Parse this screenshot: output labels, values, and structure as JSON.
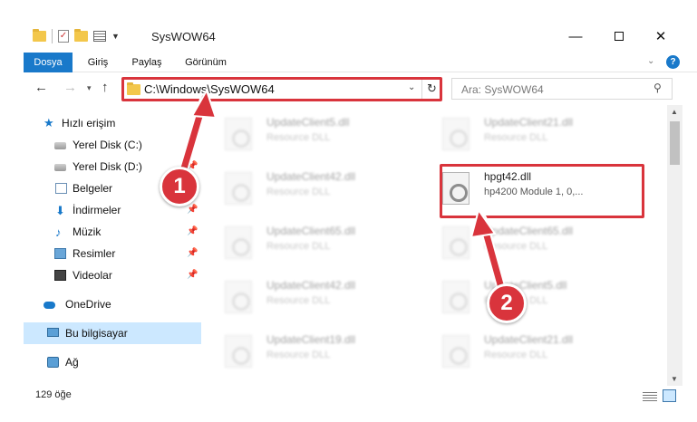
{
  "window": {
    "title": "SysWOW64",
    "minimize": "—",
    "close": "✕"
  },
  "ribbon": {
    "tabs": [
      "Dosya",
      "Giriş",
      "Paylaş",
      "Görünüm"
    ],
    "help": "?"
  },
  "address": {
    "path": "C:\\Windows\\SysWOW64",
    "search_placeholder": "Ara: SysWOW64"
  },
  "nav": {
    "items": [
      {
        "label": "Hızlı erişim",
        "icon": "star-icon"
      },
      {
        "label": "Yerel Disk (C:)",
        "icon": "drive-icon"
      },
      {
        "label": "Yerel Disk (D:)",
        "icon": "drive-icon"
      },
      {
        "label": "Belgeler",
        "icon": "documents-icon"
      },
      {
        "label": "İndirmeler",
        "icon": "downloads-icon"
      },
      {
        "label": "Müzik",
        "icon": "music-icon"
      },
      {
        "label": "Resimler",
        "icon": "pictures-icon"
      },
      {
        "label": "Videolar",
        "icon": "videos-icon"
      },
      {
        "label": "OneDrive",
        "icon": "cloud-icon"
      },
      {
        "label": "Bu bilgisayar",
        "icon": "pc-icon"
      },
      {
        "label": "Ağ",
        "icon": "network-icon"
      }
    ]
  },
  "files": [
    {
      "name": "UpdateClient5.dll",
      "desc": "Resource DLL"
    },
    {
      "name": "UpdateClient21.dll",
      "desc": "Resource DLL"
    },
    {
      "name": "UpdateClient42.dll",
      "desc": "Resource DLL"
    },
    {
      "name": "hpgt42.dll",
      "desc": "hp4200 Module 1, 0,..."
    },
    {
      "name": "UpdateClient65.dll",
      "desc": "Resource DLL"
    },
    {
      "name": "UpdateClient65.dll",
      "desc": "Resource DLL"
    },
    {
      "name": "UpdateClient42.dll",
      "desc": "Resource DLL"
    },
    {
      "name": "UpdateClient5.dll",
      "desc": "Resource DLL"
    },
    {
      "name": "UpdateClient19.dll",
      "desc": "Resource DLL"
    },
    {
      "name": "UpdateClient21.dll",
      "desc": "Resource DLL"
    }
  ],
  "status": {
    "count": "129 öğe"
  },
  "annotations": {
    "step1": "1",
    "step2": "2",
    "color": "#d9343c"
  },
  "colors": {
    "accent": "#1979ca",
    "selected": "#cce8ff"
  }
}
